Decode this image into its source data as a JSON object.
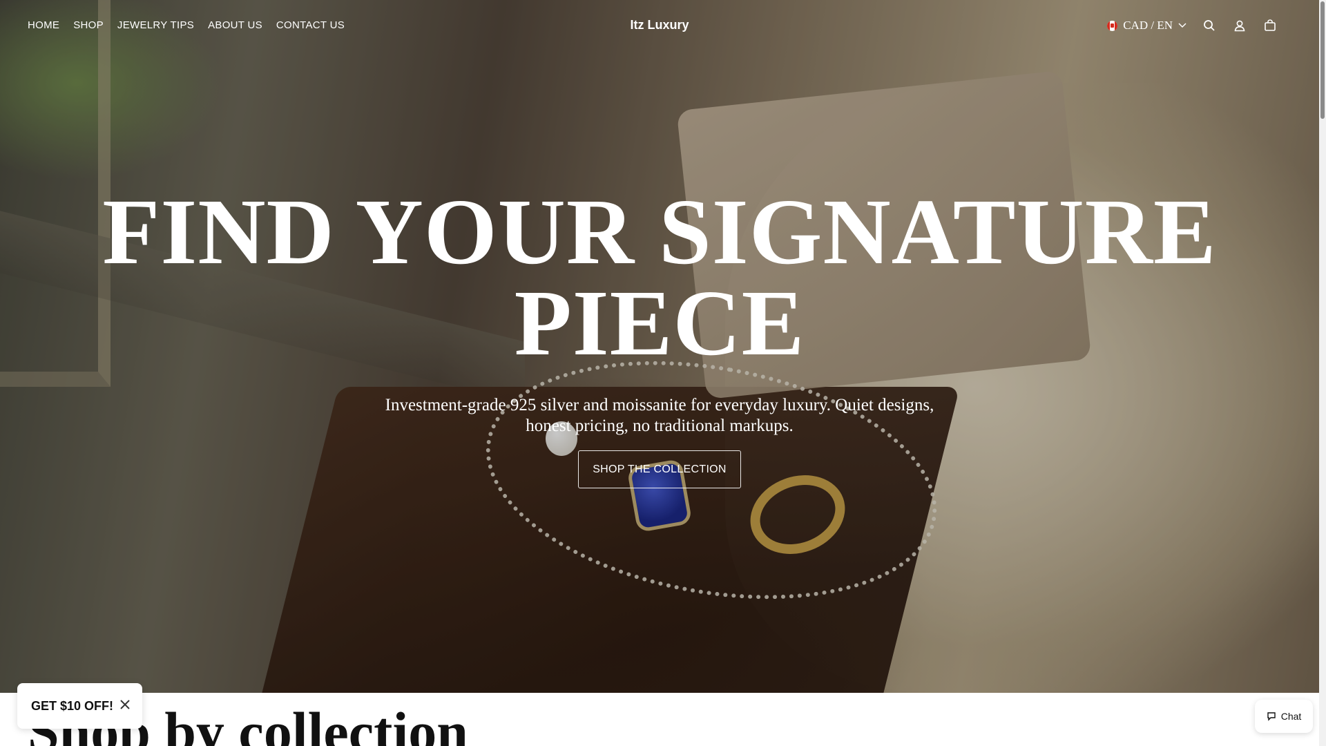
{
  "header": {
    "nav": [
      "HOME",
      "SHOP",
      "JEWELRY TIPS",
      "ABOUT US",
      "CONTACT US"
    ],
    "brand": "Itz Luxury",
    "locale": "CAD / EN"
  },
  "icons": {
    "search": "search-icon",
    "account": "account-icon",
    "cart": "cart-icon",
    "locale_chevron": "chevron-down-icon",
    "flag": "canada-flag-icon",
    "close": "close-icon",
    "chat": "chat-icon"
  },
  "hero": {
    "headline_line1": "FIND YOUR SIGNATURE",
    "headline_line2": "PIECE",
    "subcopy_line1": "Investment-grade 925 silver and moissanite for everyday luxury. Quiet designs,",
    "subcopy_line2": "honest pricing, no traditional markups.",
    "cta_label": "SHOP THE COLLECTION"
  },
  "section": {
    "title": "Shop by collection"
  },
  "promo": {
    "text": "GET $10 OFF!"
  },
  "chat": {
    "label": "Chat"
  }
}
